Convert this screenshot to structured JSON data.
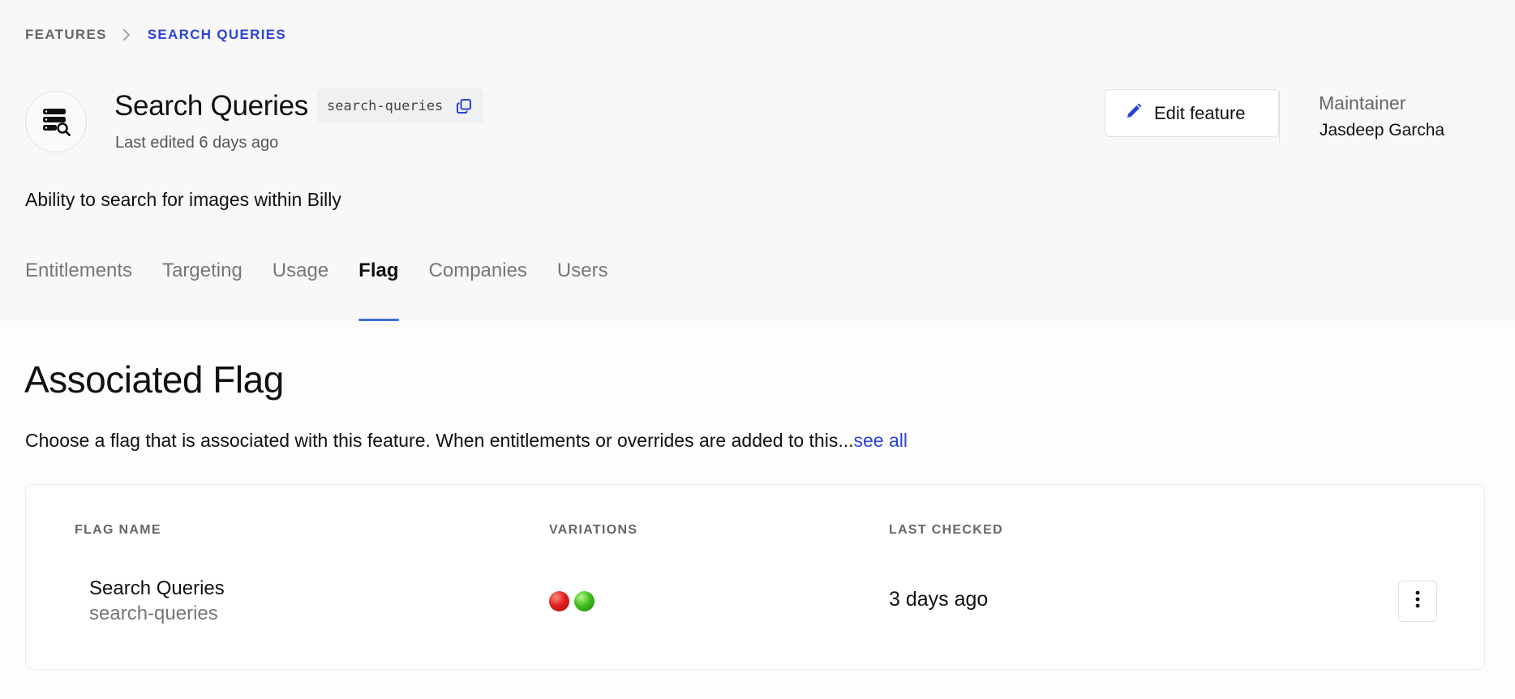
{
  "breadcrumb": {
    "root": "FEATURES",
    "current": "SEARCH QUERIES"
  },
  "feature": {
    "title": "Search Queries",
    "key": "search-queries",
    "last_edited": "Last edited 6 days ago",
    "description": "Ability to search for images within Billy",
    "icon": "database-search-icon"
  },
  "actions": {
    "edit_label": "Edit feature"
  },
  "maintainer": {
    "label": "Maintainer",
    "name": "Jasdeep Garcha"
  },
  "tabs": [
    {
      "label": "Entitlements",
      "active": false
    },
    {
      "label": "Targeting",
      "active": false
    },
    {
      "label": "Usage",
      "active": false
    },
    {
      "label": "Flag",
      "active": true
    },
    {
      "label": "Companies",
      "active": false
    },
    {
      "label": "Users",
      "active": false
    }
  ],
  "section": {
    "title": "Associated Flag",
    "description": "Choose a flag that is associated with this feature. When entitlements or overrides are added to this...",
    "see_all": "see all"
  },
  "table": {
    "headers": {
      "name": "FLAG NAME",
      "variations": "VARIATIONS",
      "last_checked": "LAST CHECKED"
    },
    "rows": [
      {
        "name": "Search Queries",
        "key": "search-queries",
        "variations": [
          "#e02020",
          "#3fbf1f"
        ],
        "last_checked": "3 days ago"
      }
    ]
  },
  "colors": {
    "accent": "#2a44d8",
    "tab_underline": "#3b6fe0"
  }
}
